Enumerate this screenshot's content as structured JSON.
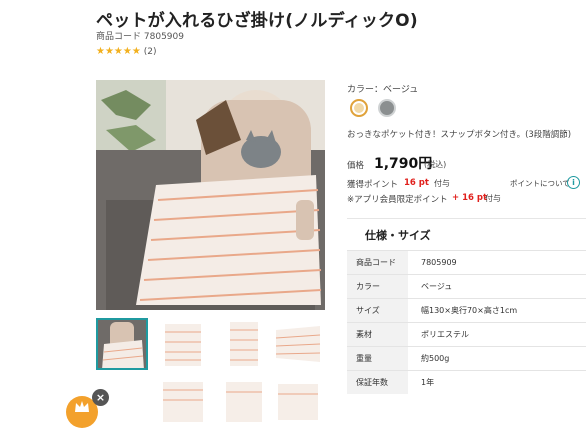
{
  "product": {
    "title": "ペットが入れるひざ掛け(ノルディックO)",
    "code_label": "商品コード",
    "code_value": "7805909",
    "stars": "★★★★★",
    "review_count": "(2)",
    "rating": 5
  },
  "options": {
    "color_label": "カラー：ベージュ",
    "swatches": [
      {
        "name": "ベージュ",
        "color": "#f2d9a6",
        "selected": true
      },
      {
        "name": "グレー",
        "color": "#8b8f90",
        "selected": false
      }
    ],
    "description": "おっきなポケット付き！スナップボタン付き。(3段階調節)"
  },
  "pricing": {
    "price_label": "価格",
    "price": "1,790",
    "currency_suffix": "円",
    "tax": "(税込)",
    "points_label": "獲得ポイント",
    "points_value": "16 pt",
    "points_suffix": "付与",
    "points_info": "ポイントについて",
    "app_points_label": "※アプリ会員限定ポイント",
    "app_points_value": "+ 16 pt",
    "app_points_suffix": "付与"
  },
  "specs": {
    "title": "仕様・サイズ",
    "rows": [
      {
        "key": "商品コード",
        "value": "7805909"
      },
      {
        "key": "カラー",
        "value": "ベージュ"
      },
      {
        "key": "サイズ",
        "value": "幅130×奥行70×高さ1cm"
      },
      {
        "key": "素材",
        "value": "ポリエステル"
      },
      {
        "key": "重量",
        "value": "約500g"
      },
      {
        "key": "保証年数",
        "value": "1年"
      }
    ]
  },
  "gallery": {
    "thumbnail_count": 8,
    "selected_index": 0
  },
  "colors": {
    "accent": "#1f9aa0",
    "price_red": "#e0201c",
    "star": "#f2b01e",
    "chat": "#f3a12c"
  }
}
